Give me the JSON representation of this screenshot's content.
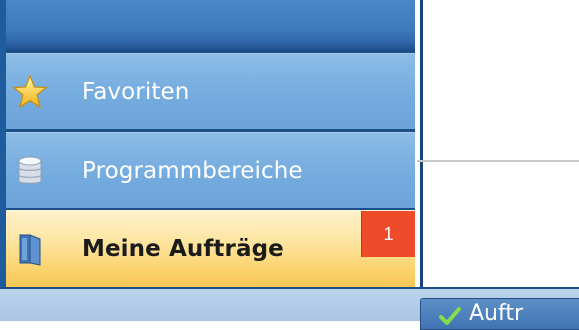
{
  "navigation": {
    "items": [
      {
        "label": "Favoriten",
        "icon": "star-icon"
      },
      {
        "label": "Programmbereiche",
        "icon": "database-icon"
      },
      {
        "label": "Meine Aufträge",
        "icon": "book-icon",
        "badge": "1",
        "active": true
      }
    ]
  },
  "bottom_tab": {
    "label": "Auftr",
    "icon": "check-icon"
  },
  "colors": {
    "nav_dark": "#1c4f8a",
    "nav_item": "#78aee0",
    "active_item": "#fbd46f",
    "badge": "#ee4b2b"
  }
}
